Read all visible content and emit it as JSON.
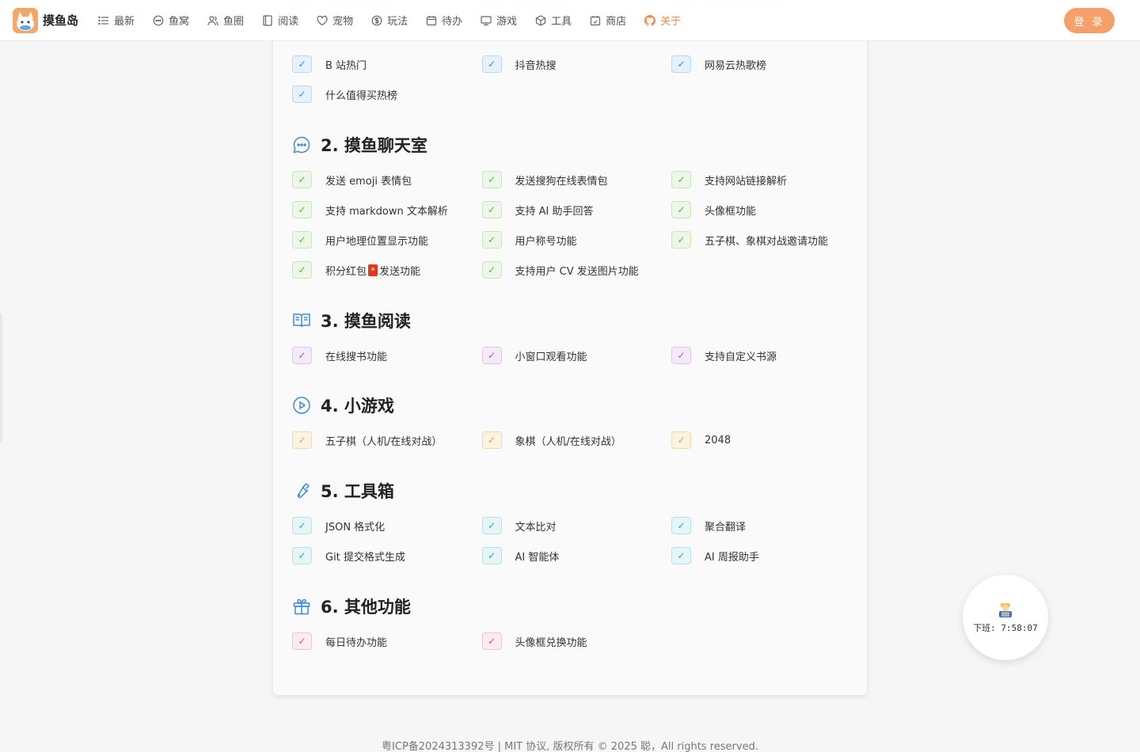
{
  "header": {
    "logo_text": "摸鱼岛",
    "nav": [
      {
        "label": "最新",
        "icon": "list-icon"
      },
      {
        "label": "鱼窝",
        "icon": "chat-icon"
      },
      {
        "label": "鱼圈",
        "icon": "users-icon"
      },
      {
        "label": "阅读",
        "icon": "book-icon"
      },
      {
        "label": "宠物",
        "icon": "heart-icon"
      },
      {
        "label": "玩法",
        "icon": "dollar-icon"
      },
      {
        "label": "待办",
        "icon": "calendar-icon"
      },
      {
        "label": "游戏",
        "icon": "monitor-icon"
      },
      {
        "label": "工具",
        "icon": "cube-icon"
      },
      {
        "label": "商店",
        "icon": "store-icon"
      },
      {
        "label": "关于",
        "icon": "github-icon"
      }
    ],
    "login_label": "登 录"
  },
  "top_rows": [
    [
      "B 站热门",
      "抖音热搜",
      "网易云热歌榜"
    ],
    [
      "什么值得买热榜"
    ]
  ],
  "sections": [
    {
      "title": "2. 摸鱼聊天室",
      "icon": "chat-bubble-icon",
      "color": "blue",
      "rows": [
        [
          "发送 emoji 表情包",
          "发送搜狗在线表情包",
          "支持网站链接解析"
        ],
        [
          "支持 markdown 文本解析",
          "支持 AI 助手回答",
          "头像框功能"
        ],
        [
          "用户地理位置显示功能",
          "用户称号功能",
          "五子棋、象棋对战邀请功能"
        ],
        [
          "积分红包",
          "支持用户 CV 发送图片功能"
        ]
      ],
      "redbag_suffix": "发送功能"
    },
    {
      "title": "3. 摸鱼阅读",
      "icon": "open-book-icon",
      "rows": [
        [
          "在线搜书功能",
          "小窗口观看功能",
          "支持自定义书源"
        ]
      ]
    },
    {
      "title": "4. 小游戏",
      "icon": "play-circle-icon",
      "rows": [
        [
          "五子棋（人机/在线对战）",
          "象棋（人机/在线对战）",
          "2048"
        ]
      ]
    },
    {
      "title": "5. 工具箱",
      "icon": "wrench-icon",
      "rows": [
        [
          "JSON 格式化",
          "文本比对",
          "聚合翻译"
        ],
        [
          "Git 提交格式生成",
          "AI 智能体",
          "AI 周报助手"
        ]
      ]
    },
    {
      "title": "6. 其他功能",
      "icon": "gift-icon",
      "rows": [
        [
          "每日待办功能",
          "头像框兑换功能"
        ]
      ]
    }
  ],
  "check_mark": "✓",
  "timer": {
    "text": "下班: 7:58:07"
  },
  "footer": {
    "text": "粤ICP备2024313392号  |  MIT 协议, 版权所有 © 2025 聪，All rights reserved."
  },
  "colors": {
    "accent": "#f08a4b",
    "login_bg": "#f5a06b",
    "icon_blue": "#3f8ad8"
  }
}
